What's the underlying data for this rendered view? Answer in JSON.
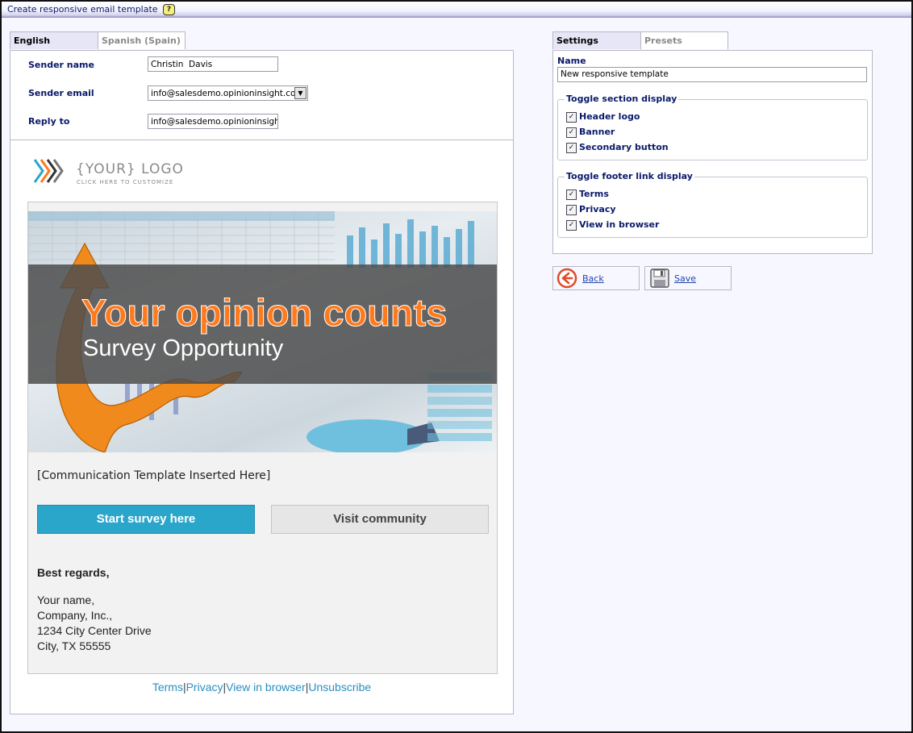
{
  "window": {
    "title": "Create responsive email template"
  },
  "language_tabs": [
    {
      "label": "English",
      "active": true
    },
    {
      "label": "Spanish (Spain)",
      "active": false
    }
  ],
  "sender": {
    "name_label": "Sender name",
    "name_value": "Christin  Davis",
    "email_label": "Sender email",
    "email_value": "info@salesdemo.opinioninsight.com",
    "reply_label": "Reply to",
    "reply_value": "info@salesdemo.opinioninsight.c"
  },
  "email": {
    "logo_text": "{YOUR} LOGO",
    "logo_subtext": "CLICK HERE TO CUSTOMIZE",
    "banner_headline": "Your opinion counts",
    "banner_subheadline": "Survey Opportunity",
    "placeholder": "[Communication Template Inserted Here]",
    "primary_button": "Start survey here",
    "secondary_button": "Visit community",
    "regards": "Best regards,",
    "address_lines": [
      "Your name,",
      "Company, Inc.,",
      "1234 City Center Drive",
      "City, TX 55555"
    ],
    "footer_links": [
      "Terms",
      "Privacy",
      "View in browser",
      "Unsubscribe"
    ],
    "footer_separator": "|"
  },
  "settings_tabs": [
    {
      "label": "Settings",
      "active": true
    },
    {
      "label": "Presets",
      "active": false
    }
  ],
  "settings": {
    "name_label": "Name",
    "name_value": "New responsive template",
    "section_group": {
      "legend": "Toggle section display",
      "items": [
        {
          "label": "Header logo",
          "checked": true
        },
        {
          "label": "Banner",
          "checked": true
        },
        {
          "label": "Secondary button",
          "checked": true
        }
      ]
    },
    "footer_group": {
      "legend": "Toggle footer link display",
      "items": [
        {
          "label": "Terms",
          "checked": true
        },
        {
          "label": "Privacy",
          "checked": true
        },
        {
          "label": "View in browser",
          "checked": true
        }
      ]
    }
  },
  "actions": {
    "back_label": "Back",
    "save_label": "Save",
    "back_icon": "back-arrow-icon",
    "save_icon": "floppy-disk-icon"
  },
  "colors": {
    "accent_blue": "#2ba6cb",
    "headline_orange": "#ff7a1c",
    "link_blue": "#2b8ec0",
    "back_red": "#e04a2a"
  }
}
